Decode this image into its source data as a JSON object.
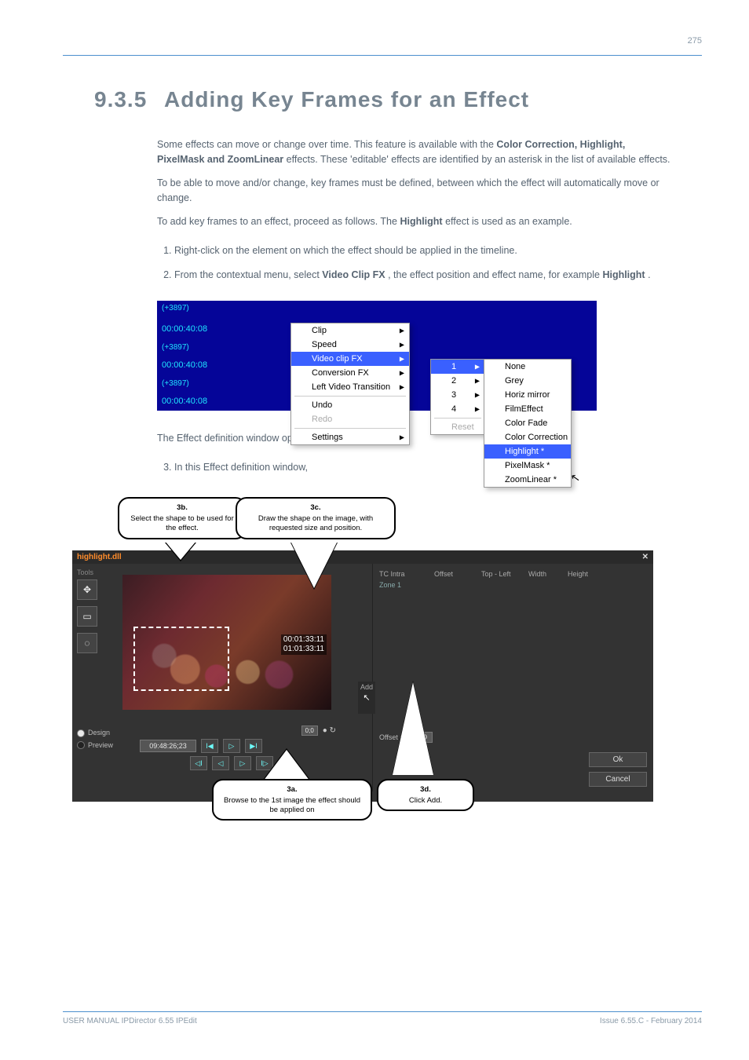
{
  "header": {
    "page_no": "275"
  },
  "section": {
    "number": "9.3.5",
    "title": "Adding Key Frames for an Effect"
  },
  "intro": {
    "p1_prefix": "Some effects can move or change over time. This feature is available with the ",
    "fx_list": "Color Correction, Highlight, PixelMask and ZoomLinear",
    "p1_suffix": " effects. These 'editable' effects are identified by an asterisk in the list of available effects.",
    "p2": "To be able to move and/or change, key frames must be defined, between which the effect will automatically move or change.",
    "p3_prefix": "To add key frames to an effect, proceed as follows. The ",
    "p3_bold": "Highlight",
    "p3_suffix": " effect is used as an example."
  },
  "steps": {
    "s1": "Right-click on the element on which the effect should be applied in the timeline.",
    "s2_prefix": "From the contextual menu, select ",
    "s2_bold": "Video Clip FX",
    "s2_mid": ", the effect position and effect name, for example ",
    "s2_bold2": "Highlight",
    "s2_suffix": "."
  },
  "fig1": {
    "timeline_label": "(+3897)",
    "timecode": "00:00:40:08",
    "menu1": [
      "Clip",
      "Speed",
      "Video clip FX",
      "Conversion FX",
      "Left Video Transition",
      "Undo",
      "Redo",
      "Settings"
    ],
    "menu1_sel": "Video clip FX",
    "menu1_disabled": "Redo",
    "menu2": [
      "1",
      "2",
      "3",
      "4",
      "Reset"
    ],
    "menu2_sel": "1",
    "menu2_disabled": "Reset",
    "menu3": [
      "None",
      "Grey",
      "Horiz mirror",
      "FilmEffect",
      "Color Fade",
      "Color Correction",
      "Highlight *",
      "PixelMask *",
      "ZoomLinear *"
    ],
    "menu3_sel": "Highlight *"
  },
  "steps2": {
    "line": "The Effect definition window opens.",
    "s3": "In this Effect definition window,"
  },
  "callouts": {
    "c3b_t": "3b.",
    "c3b": "Select the shape to be used for the effect.",
    "c3c_t": "3c.",
    "c3c": "Draw the shape on the image, with requested size and position.",
    "c3a_t": "3a.",
    "c3a": "Browse to the 1st image the effect should be applied on",
    "c3d_t": "3d.",
    "c3d": "Click Add."
  },
  "dialog": {
    "title": "highlight.dll",
    "close": "✕",
    "tools_label": "Tools",
    "preview_tc1": "00:01:33:11",
    "preview_tc2": "01:01:33:11",
    "add_label": "Add",
    "design": "Design",
    "preview": "Preview",
    "tc_field": "09:48:26;23",
    "tc_small": "0;0",
    "cols": [
      "TC Intra",
      "Offset",
      "Top - Left",
      "Width",
      "Height"
    ],
    "zone1": "Zone 1",
    "offset_label": "Offset :",
    "offset_minus": "-",
    "offset_val": "60",
    "ok": "Ok",
    "cancel": "Cancel"
  },
  "footer": {
    "left": "USER MANUAL IPDirector 6.55 IPEdit",
    "right": "Issue 6.55.C - February 2014"
  }
}
